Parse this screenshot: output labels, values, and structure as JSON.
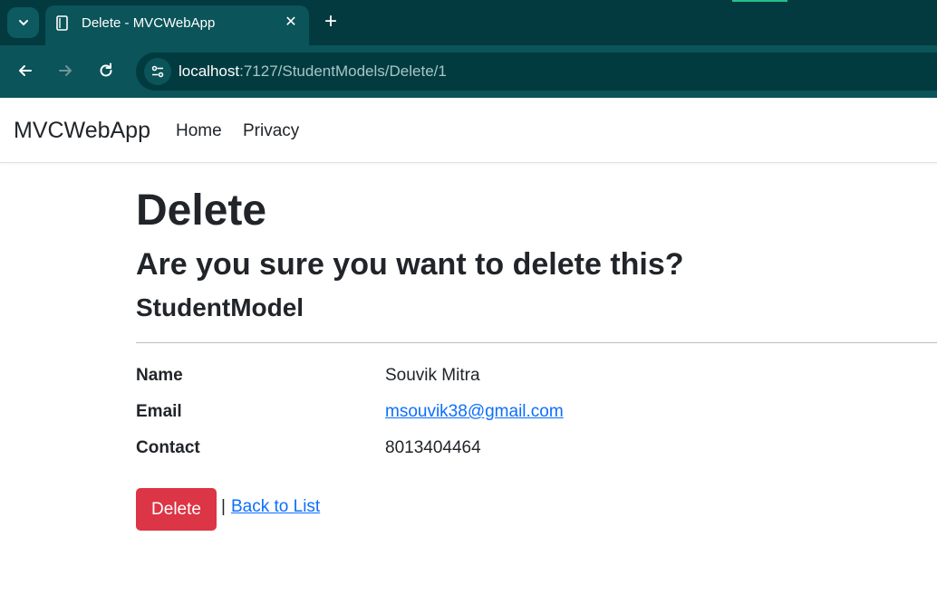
{
  "browser": {
    "tab_title": "Delete - MVCWebApp",
    "url_host": "localhost",
    "url_path": ":7127/StudentModels/Delete/1"
  },
  "navbar": {
    "brand": "MVCWebApp",
    "links": [
      "Home",
      "Privacy"
    ]
  },
  "page": {
    "heading": "Delete",
    "question": "Are you sure you want to delete this?",
    "model_name": "StudentModel"
  },
  "details": [
    {
      "label": "Name",
      "value": "Souvik Mitra"
    },
    {
      "label": "Email",
      "value": "msouvik38@gmail.com"
    },
    {
      "label": "Contact",
      "value": "8013404464"
    }
  ],
  "actions": {
    "delete_label": "Delete",
    "separator": "|",
    "back_label": "Back to List"
  },
  "colors": {
    "danger": "#dc3545",
    "link": "#0d6efd",
    "chrome_dark": "#023a40",
    "chrome_toolbar": "#0b5459"
  }
}
